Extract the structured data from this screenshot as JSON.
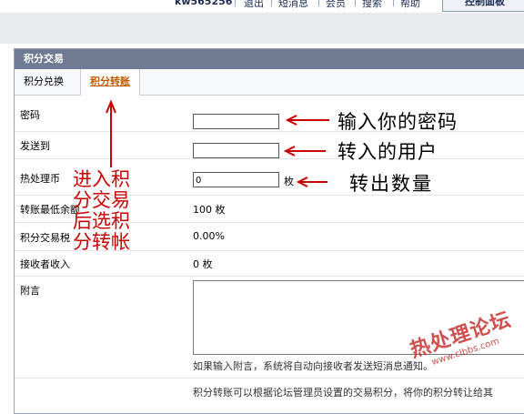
{
  "header": {
    "username": "kw565256",
    "links": [
      "退出",
      "短消息",
      "会员",
      "搜索",
      "帮助"
    ],
    "control_panel": "控制面板"
  },
  "panel": {
    "title": "积分交易",
    "tabs": [
      {
        "label": "积分兑换",
        "active": false
      },
      {
        "label": "积分转账",
        "active": true
      }
    ]
  },
  "form": {
    "password_label": "密码",
    "password_value": "",
    "send_to_label": "发送到",
    "send_to_value": "",
    "currency_label": "热处理币",
    "currency_value": "0",
    "currency_unit": "枚",
    "min_balance_label": "转账最低余额",
    "min_balance_value": "100 枚",
    "tax_label": "积分交易税",
    "tax_value": "0.00%",
    "receiver_income_label": "接收者收入",
    "receiver_income_value": "0 枚",
    "message_label": "附言",
    "message_hint": "如果输入附言，系统将自动向接收者发送短消息通知。",
    "footer_text": "积分转账可以根据论坛管理员设置的交易积分，将你的积分转让给其"
  },
  "annotations": {
    "password": "输入你的密码",
    "user": "转入的用户",
    "amount": "转出数量",
    "left_lines": [
      "进入积",
      "分交易",
      "后选积",
      "分转帐"
    ]
  },
  "watermark": {
    "text": "热处理论坛",
    "url": "www.clbbs.com"
  },
  "colors": {
    "panel_header": "#6f7a93",
    "active_tab": "#c25a00",
    "annotation_arrow": "#c80000"
  }
}
